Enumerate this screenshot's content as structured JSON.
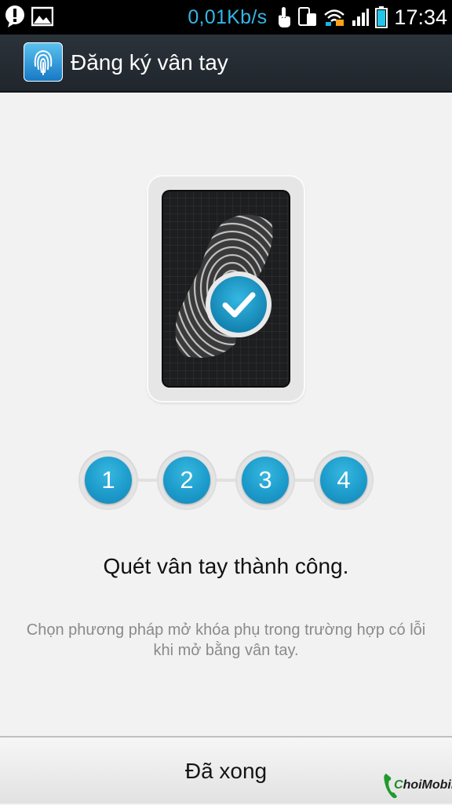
{
  "status_bar": {
    "network_speed": "0,01Kb/s",
    "time": "17:34",
    "left_icons": [
      "alert-icon",
      "image-notification-icon"
    ],
    "right_icons": [
      "touch-icon",
      "screen-mirror-icon",
      "wifi-icon",
      "signal-icon",
      "battery-icon"
    ]
  },
  "action_bar": {
    "title": "Đăng ký vân tay",
    "icon": "fingerprint-icon"
  },
  "illustration": {
    "icon": "fingerprint-scan-success",
    "check_icon": "checkmark-icon"
  },
  "steps": [
    {
      "label": "1"
    },
    {
      "label": "2"
    },
    {
      "label": "3"
    },
    {
      "label": "4"
    }
  ],
  "message": {
    "headline": "Quét vân tay thành công.",
    "hint": "Chọn phương pháp mở khóa phụ trong trường hợp có lỗi khi mở bằng vân tay."
  },
  "done_button": {
    "label": "Đã xong"
  },
  "watermark": {
    "text_c": "C",
    "text_rest": "hoiMobile"
  },
  "colors": {
    "accent": "#1d9ccc",
    "action_bar": "#262c33",
    "background": "#f2f2f2",
    "status_speed": "#35b6e6"
  }
}
